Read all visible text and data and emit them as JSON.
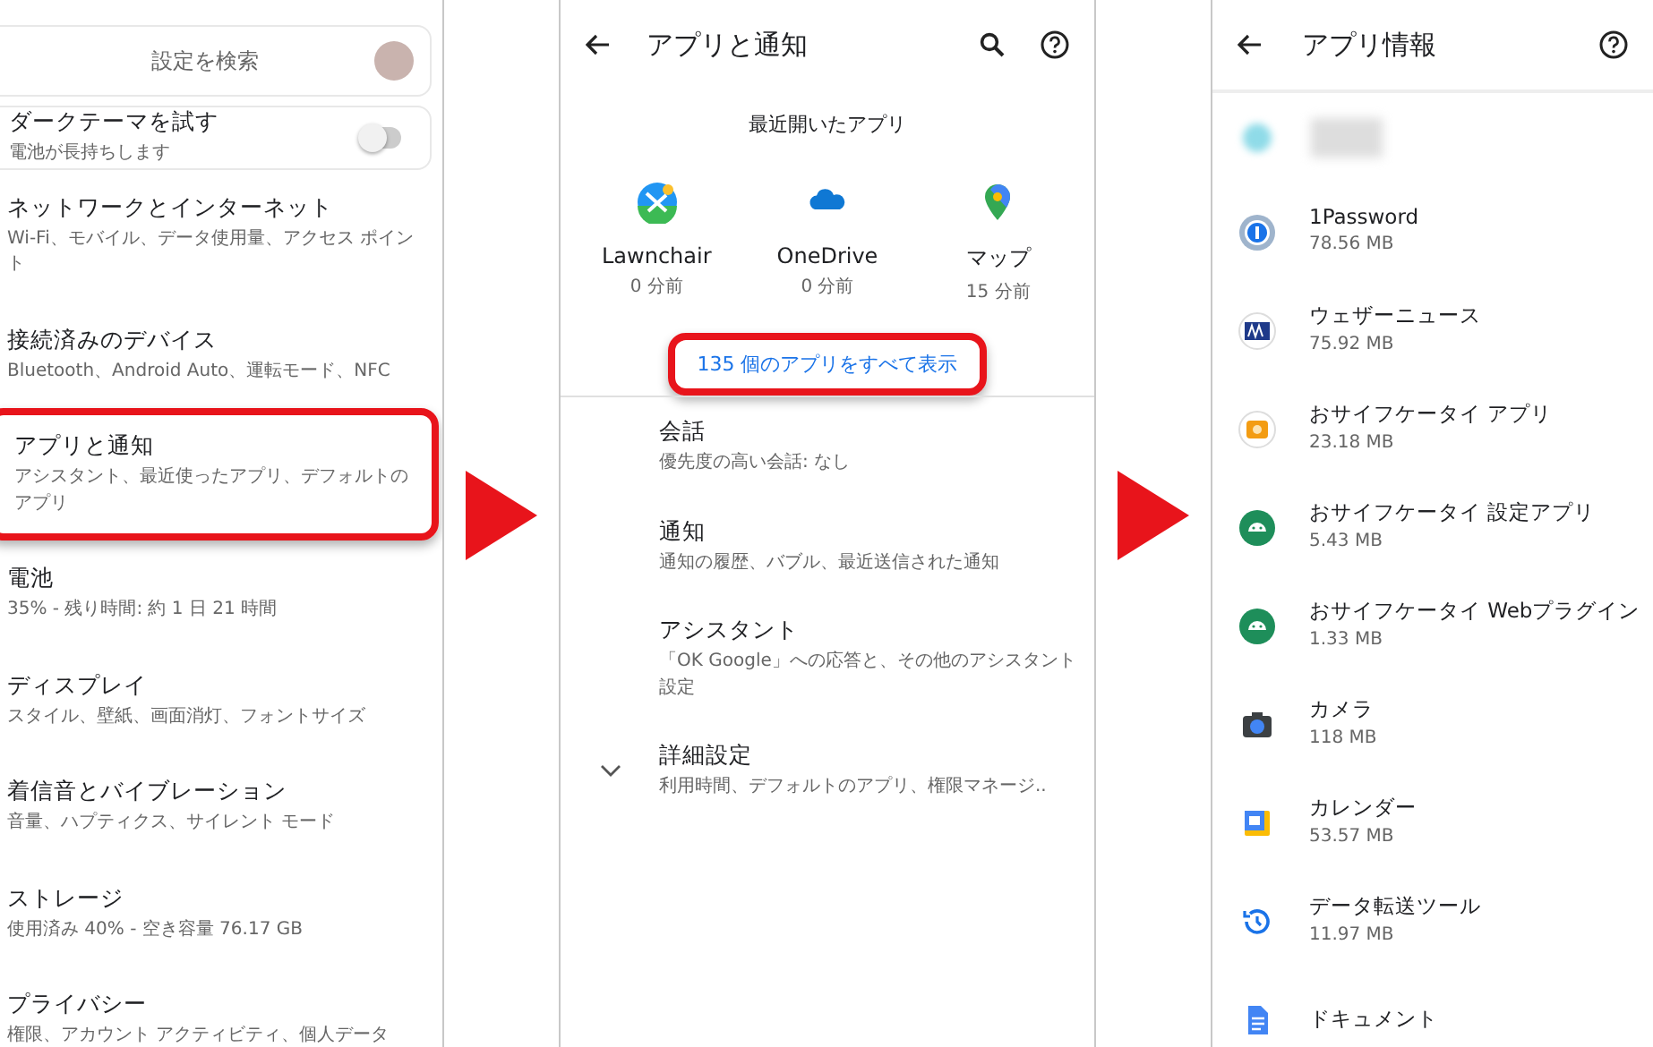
{
  "settings": {
    "search": {
      "placeholder": "設定を検索"
    },
    "dark_theme": {
      "title": "ダークテーマを試す",
      "subtitle": "電池が長持ちします",
      "on": false
    },
    "items": [
      {
        "title": "ネットワークとインターネット",
        "subtitle": "Wi-Fi、モバイル、データ使用量、アクセス ポイント",
        "highlighted": false
      },
      {
        "title": "接続済みのデバイス",
        "subtitle": "Bluetooth、Android Auto、運転モード、NFC",
        "highlighted": false
      },
      {
        "title": "アプリと通知",
        "subtitle": "アシスタント、最近使ったアプリ、デフォルトのアプリ",
        "highlighted": true
      },
      {
        "title": "電池",
        "subtitle": "35% - 残り時間: 約 1 日 21 時間",
        "highlighted": false
      },
      {
        "title": "ディスプレイ",
        "subtitle": "スタイル、壁紙、画面消灯、フォントサイズ",
        "highlighted": false
      },
      {
        "title": "着信音とバイブレーション",
        "subtitle": "音量、ハプティクス、サイレント モード",
        "highlighted": false
      },
      {
        "title": "ストレージ",
        "subtitle": "使用済み 40% - 空き容量 76.17 GB",
        "highlighted": false
      },
      {
        "title": "プライバシー",
        "subtitle": "権限、アカウント アクティビティ、個人データ",
        "highlighted": false
      }
    ]
  },
  "apps_notifications": {
    "title": "アプリと通知",
    "recent_heading": "最近開いたアプリ",
    "recent_apps": [
      {
        "name": "Lawnchair",
        "time": "0 分前"
      },
      {
        "name": "OneDrive",
        "time": "0 分前"
      },
      {
        "name": "マップ",
        "time": "15 分前"
      }
    ],
    "see_all": {
      "label": "135 個のアプリをすべて表示",
      "highlighted": true
    },
    "items": [
      {
        "title": "会話",
        "subtitle": "優先度の高い会話: なし",
        "expandable": false
      },
      {
        "title": "通知",
        "subtitle": "通知の履歴、バブル、最近送信された通知",
        "expandable": false
      },
      {
        "title": "アシスタント",
        "subtitle": "「OK Google」への応答と、その他のアシスタント設定",
        "expandable": false
      },
      {
        "title": "詳細設定",
        "subtitle": "利用時間、デフォルトのアプリ、権限マネージ..",
        "expandable": true
      }
    ]
  },
  "app_info": {
    "title": "アプリ情報",
    "apps": [
      {
        "name": "1Password",
        "size": "78.56 MB"
      },
      {
        "name": "ウェザーニュース",
        "size": "75.92 MB"
      },
      {
        "name": "おサイフケータイ アプリ",
        "size": "23.18 MB"
      },
      {
        "name": "おサイフケータイ 設定アプリ",
        "size": "5.43 MB"
      },
      {
        "name": "おサイフケータイ Webプラグイン",
        "size": "1.33 MB"
      },
      {
        "name": "カメラ",
        "size": "118 MB"
      },
      {
        "name": "カレンダー",
        "size": "53.57 MB"
      },
      {
        "name": "データ転送ツール",
        "size": "11.97 MB"
      },
      {
        "name": "ドキュメント"
      }
    ]
  }
}
